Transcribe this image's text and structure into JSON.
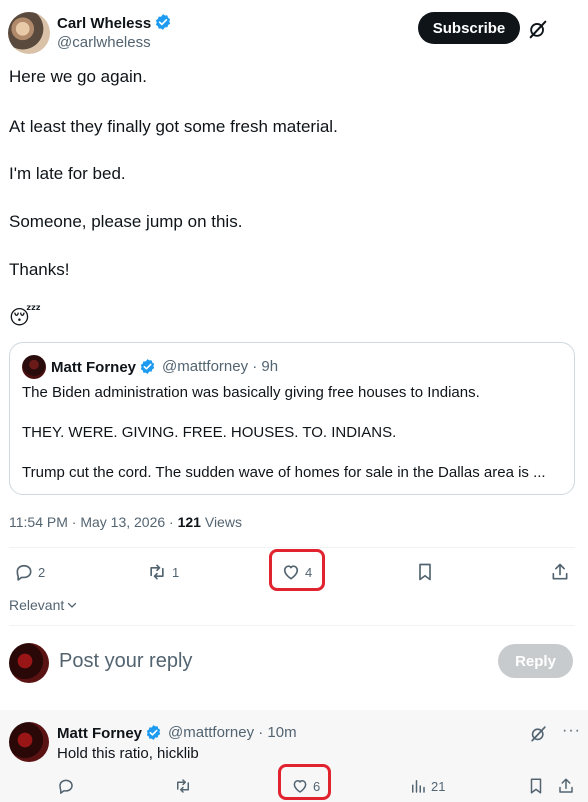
{
  "post": {
    "author_name": "Carl Wheless",
    "author_handle": "@carlwheless",
    "subscribe_label": "Subscribe",
    "paragraphs": [
      "Here we go again.",
      "At least they finally got some fresh material.",
      "I'm late for bed.",
      "Someone, please jump on this.",
      "Thanks!"
    ],
    "emoji": "😴",
    "quote": {
      "author_name": "Matt Forney",
      "author_handle": "@mattforney",
      "time": "· 9h",
      "lines": [
        "The Biden administration was basically giving free houses to Indians.",
        "THEY. WERE. GIVING. FREE. HOUSES. TO. INDIANS.",
        "Trump cut the cord. The sudden wave of homes for sale in the Dallas area is ..."
      ]
    },
    "timestamp": "11:54 PM · May 13, 2026 · ",
    "views_count": "121",
    "views_label": " Views",
    "stats": {
      "replies": "2",
      "reposts": "1",
      "likes": "4"
    },
    "sort_label": "Relevant"
  },
  "composer": {
    "placeholder": "Post your reply",
    "reply_button": "Reply"
  },
  "reply": {
    "author_name": "Matt Forney",
    "author_handle": "@mattforney",
    "time": "· 10m",
    "text": "Hold this ratio, hicklib",
    "stats": {
      "likes": "6",
      "views": "21"
    }
  },
  "colors": {
    "verified_blue": "#1d9bf0",
    "highlight_red": "#e0232e",
    "muted_text": "#536471"
  }
}
